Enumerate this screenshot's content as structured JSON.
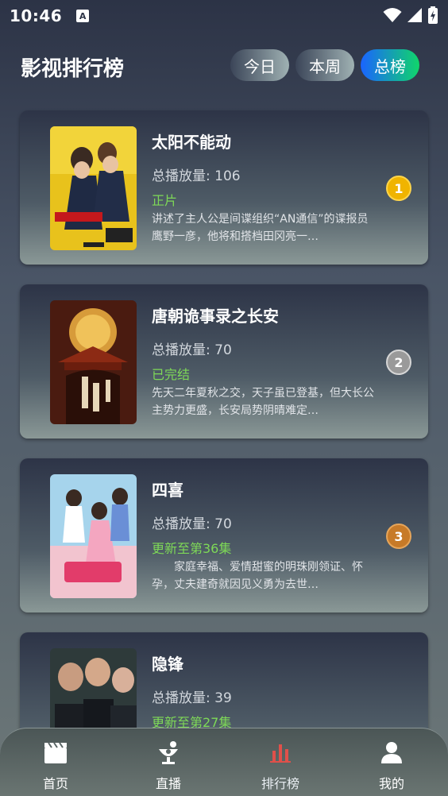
{
  "status_bar": {
    "time": "10:46",
    "a_glyph": "A"
  },
  "header": {
    "title": "影视排行榜",
    "tabs": [
      {
        "label": "今日",
        "active": false
      },
      {
        "label": "本周",
        "active": false
      },
      {
        "label": "总榜",
        "active": true
      }
    ]
  },
  "list": [
    {
      "title": "太阳不能动",
      "plays": "总播放量: 106",
      "status": "正片",
      "desc": "讲述了主人公是间谍组织“AN通信”的谍报员鹰野一彦，他将和搭档田冈亮一…",
      "rank": "1",
      "rank_color": "#f0b400"
    },
    {
      "title": "唐朝诡事录之长安",
      "plays": "总播放量: 70",
      "status": "已完结",
      "desc": "先天二年夏秋之交，天子虽已登基，但大长公主势力更盛，长安局势阴晴难定…",
      "rank": "2",
      "rank_color": "#9a9a9a"
    },
    {
      "title": "四喜",
      "plays": "总播放量: 70",
      "status": "更新至第36集",
      "desc": "　　家庭幸福、爱情甜蜜的明珠刚领证、怀孕，丈夫建奇就因见义勇为去世…",
      "rank": "3",
      "rank_color": "#c77a28"
    },
    {
      "title": "隐锋",
      "plays": "总播放量: 39",
      "status": "更新至第27集",
      "desc": "",
      "rank": "",
      "rank_color": ""
    }
  ],
  "bottom_nav": [
    {
      "label": "首页",
      "icon": "clapperboard-icon",
      "active": false
    },
    {
      "label": "直播",
      "icon": "live-dish-icon",
      "active": false
    },
    {
      "label": "排行榜",
      "icon": "bar-chart-icon",
      "active": true
    },
    {
      "label": "我的",
      "icon": "person-icon",
      "active": false
    }
  ],
  "colors": {
    "accent_green": "#7ed957",
    "active_nav": "#e0504a"
  }
}
